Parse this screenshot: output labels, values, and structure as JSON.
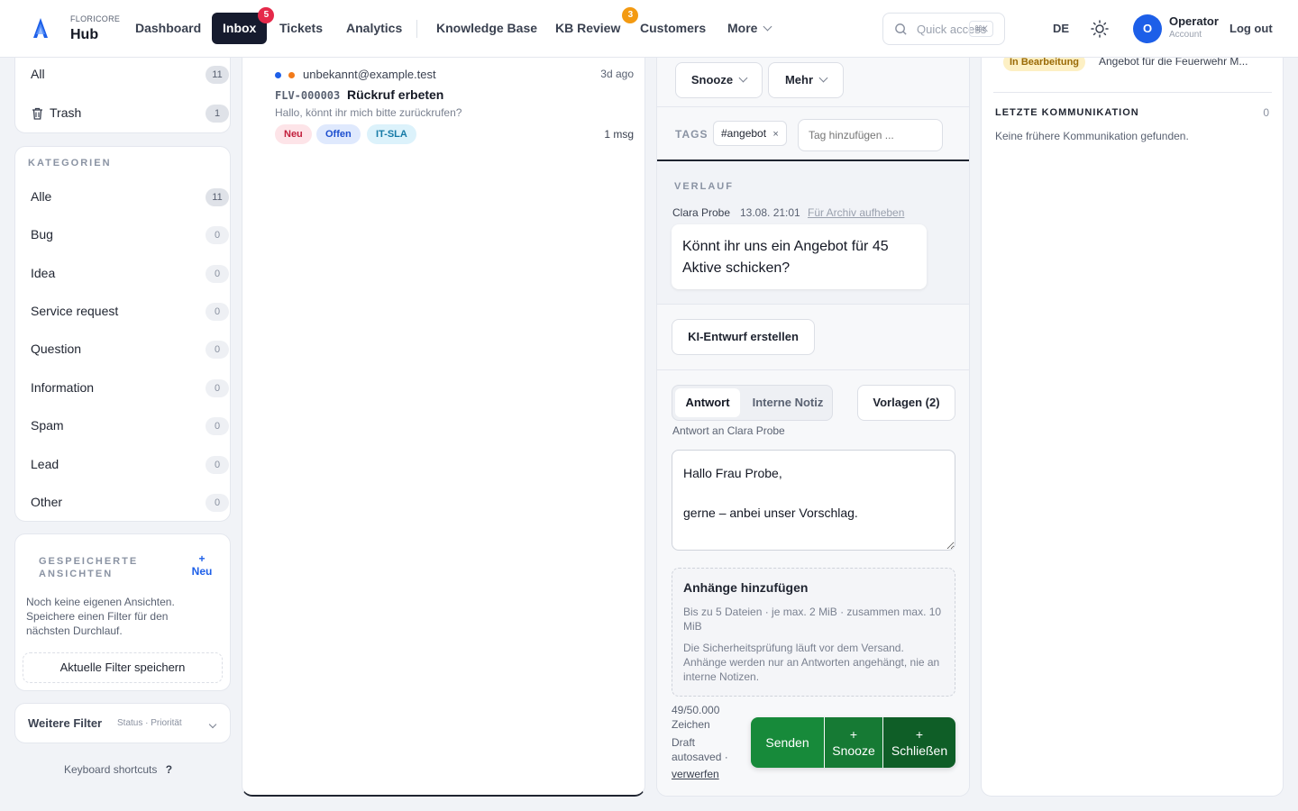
{
  "brand": {
    "small": "FLORICORE",
    "name": "Hub"
  },
  "nav": {
    "items": [
      {
        "label": "Dashboard"
      },
      {
        "label": "Inbox",
        "badge": "5"
      },
      {
        "label": "Tickets"
      },
      {
        "label": "Analytics"
      },
      {
        "label": "Knowledge Base"
      },
      {
        "label": "KB Review",
        "badge": "3"
      },
      {
        "label": "Customers"
      },
      {
        "label": "More"
      }
    ],
    "quick_access": "Quick access",
    "quick_kbd": "⌘K",
    "lang": "DE",
    "user_initial": "O",
    "user_name": "Operator",
    "user_sub": "Account",
    "logout": "Log out"
  },
  "sidebar": {
    "top_items": [
      {
        "label": "All",
        "count": "11"
      },
      {
        "label": "Trash",
        "count": "1"
      }
    ],
    "categories_title": "KATEGORIEN",
    "categories": [
      {
        "label": "Alle",
        "count": "11"
      },
      {
        "label": "Bug",
        "count": "0"
      },
      {
        "label": "Idea",
        "count": "0"
      },
      {
        "label": "Service request",
        "count": "0"
      },
      {
        "label": "Question",
        "count": "0"
      },
      {
        "label": "Information",
        "count": "0"
      },
      {
        "label": "Spam",
        "count": "0"
      },
      {
        "label": "Lead",
        "count": "0"
      },
      {
        "label": "Other",
        "count": "0"
      }
    ],
    "saved_views_title_1": "GESPEICHERTE",
    "saved_views_title_2": "ANSICHTEN",
    "new_plus": "+",
    "new_label": "Neu",
    "saved_views_empty": "Noch keine eigenen Ansichten. Speichere einen Filter für den nächsten Durchlauf.",
    "save_filter": "Aktuelle Filter speichern",
    "more_filters": "Weitere Filter",
    "more_filters_hint": "Status · Priorität",
    "shortcuts": "Keyboard shortcuts",
    "shortcuts_key": "?"
  },
  "list": {
    "items": [
      {
        "sender": "unbekannt@example.test",
        "age": "3d ago",
        "ticket_id": "FLV-000003",
        "subject": "Rückruf erbeten",
        "preview": "Hallo, könnt ihr mich bitte zurückrufen?",
        "tags": [
          "Neu",
          "Offen",
          "IT-SLA"
        ],
        "msgs": "1 msg"
      }
    ]
  },
  "detail": {
    "snooze": "Snooze",
    "mehr": "Mehr",
    "tags_label": "TAGS",
    "tag": "#angebot",
    "tag_remove": "×",
    "tag_placeholder": "Tag hinzufügen ...",
    "history_title": "VERLAUF",
    "msg_author": "Clara Probe",
    "msg_time": "13.08. 21:01",
    "msg_archive": "Für Archiv aufheben",
    "msg_body": "Könnt ihr uns ein Angebot für 45 Aktive schicken?",
    "ai_draft": "KI-Entwurf erstellen",
    "tab_reply": "Antwort",
    "tab_note": "Interne Notiz",
    "templates": "Vorlagen (2)",
    "reply_to": "Antwort an Clara Probe",
    "reply_text": "Hallo Frau Probe,\n\ngerne – anbei unser Vorschlag.",
    "attach_title": "Anhänge hinzufügen",
    "attach_limits": "Bis zu 5 Dateien · je max. 2 MiB · zusammen max. 10 MiB",
    "attach_info": "Die Sicherheitsprüfung läuft vor dem Versand. Anhänge werden nur an Antworten angehängt, nie an interne Notizen.",
    "char_count": "49/50.000 Zeichen",
    "draft_status": "Draft autosaved ·",
    "discard": "verwerfen",
    "send": "Senden",
    "send_snooze_plus": "+",
    "send_snooze": "Snooze",
    "send_close_plus": "+",
    "send_close": "Schließen"
  },
  "right": {
    "status_badge": "In Bearbeitung",
    "status_text": "Angebot für die Feuerwehr M...",
    "last_comm_title": "LETZTE KOMMUNIKATION",
    "last_comm_count": "0",
    "last_comm_empty": "Keine frühere Kommunikation gefunden."
  },
  "colors": {
    "accent": "#1d5fe8",
    "nav_active": "#161b2e",
    "send_green": "#178a3a",
    "badge_red": "#e5294a",
    "badge_orange": "#f39a12"
  }
}
